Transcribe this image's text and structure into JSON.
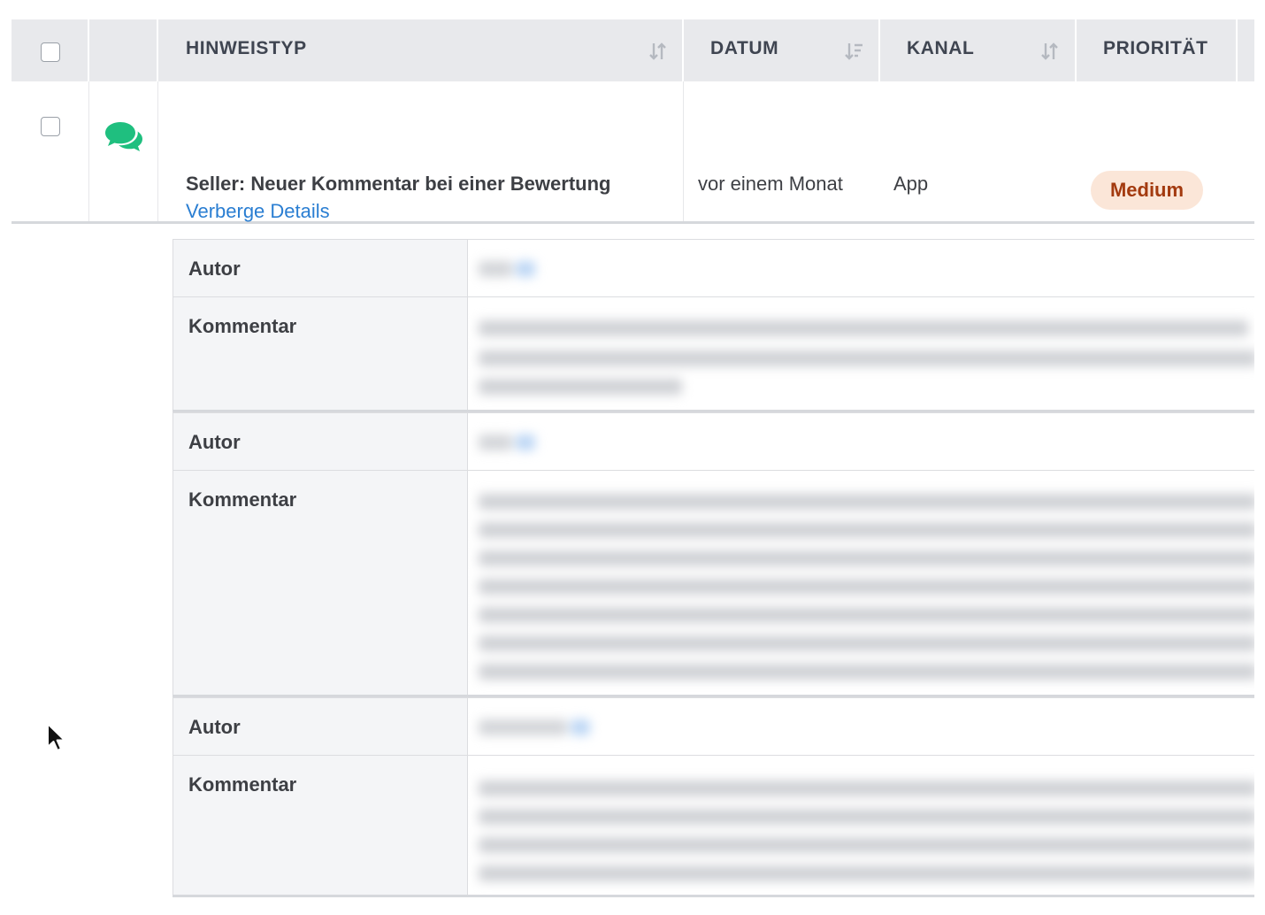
{
  "table": {
    "columns": [
      {
        "key": "type",
        "label": "HINWEISTYP",
        "sortable": true
      },
      {
        "key": "date",
        "label": "DATUM",
        "sortable": true
      },
      {
        "key": "channel",
        "label": "KANAL",
        "sortable": true
      },
      {
        "key": "priority",
        "label": "PRIORITÄT",
        "sortable": false
      }
    ],
    "row": {
      "title": "Seller: Neuer Kommentar bei einer Bewertung",
      "toggle_label": "Verberge Details",
      "date": "vor einem Monat",
      "channel": "App",
      "priority": "Medium",
      "icon": "chat-bubbles-icon"
    }
  },
  "details": {
    "entries": [
      {
        "author_label": "Autor",
        "comment_label": "Kommentar"
      },
      {
        "author_label": "Autor",
        "comment_label": "Kommentar"
      },
      {
        "author_label": "Autor",
        "comment_label": "Kommentar"
      }
    ]
  },
  "colors": {
    "header_bg": "#e8e9ec",
    "link": "#2a7ed2",
    "chat_icon": "#1fbf7f",
    "badge_bg": "#fbe6d8",
    "badge_text": "#a33a0f"
  }
}
